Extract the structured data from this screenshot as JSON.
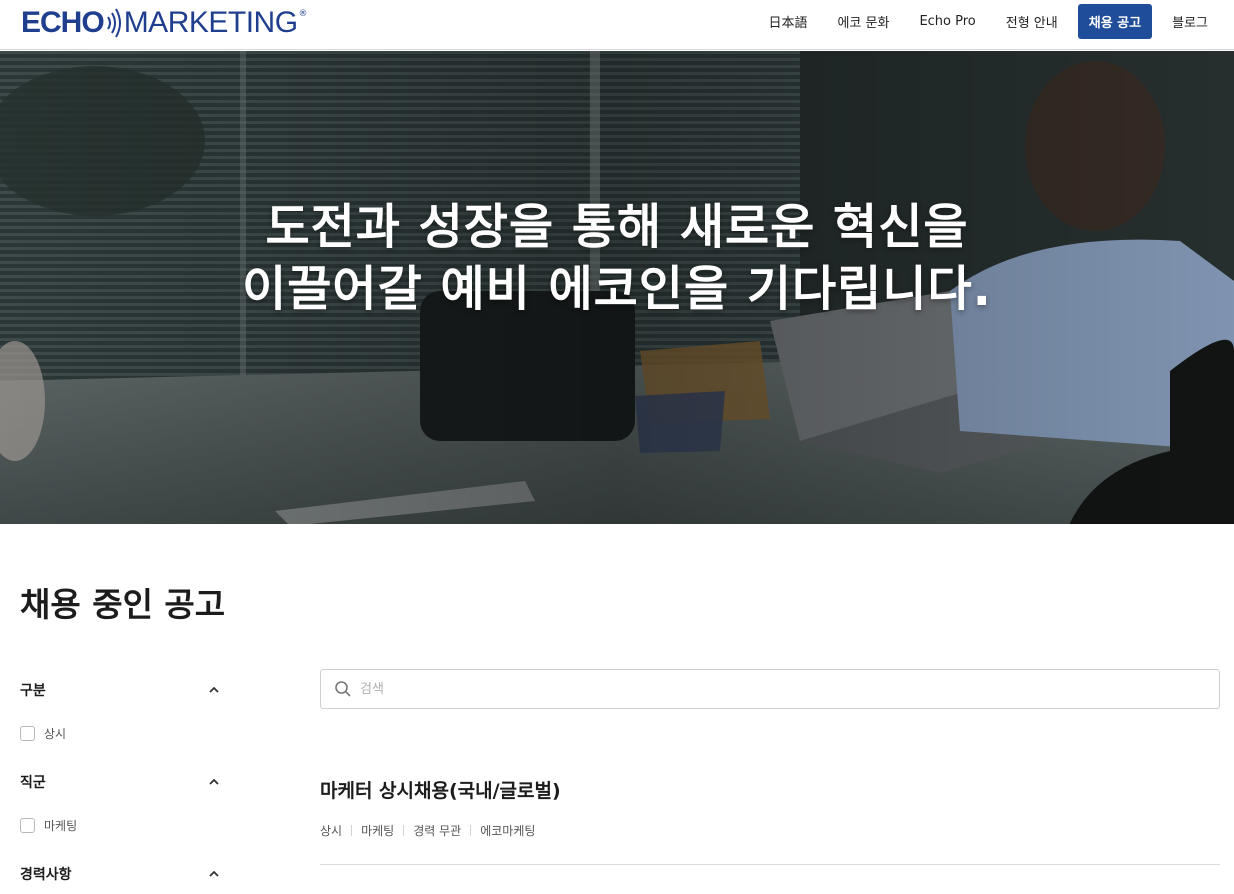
{
  "header": {
    "logo": {
      "brand_bold": "ECHO",
      "brand_light": "MARKETING",
      "reg_mark": "®"
    },
    "nav": [
      {
        "label": "日本語",
        "active": false
      },
      {
        "label": "에코 문화",
        "active": false
      },
      {
        "label": "Echo Pro",
        "active": false
      },
      {
        "label": "전형 안내",
        "active": false
      },
      {
        "label": "채용 공고",
        "active": true
      },
      {
        "label": "블로그",
        "active": false
      }
    ]
  },
  "hero": {
    "line1": "도전과 성장을 통해 새로운 혁신을",
    "line2": "이끌어갈 예비 에코인을 기다립니다."
  },
  "section": {
    "title": "채용 중인 공고"
  },
  "filters": [
    {
      "label": "구분",
      "options": [
        "상시"
      ]
    },
    {
      "label": "직군",
      "options": [
        "마케팅"
      ]
    },
    {
      "label": "경력사항",
      "options": []
    }
  ],
  "search": {
    "placeholder": "검색",
    "value": ""
  },
  "jobs": [
    {
      "title": "마케터 상시채용(국내/글로벌)",
      "tags": [
        "상시",
        "마케팅",
        "경력 무관",
        "에코마케팅"
      ]
    }
  ],
  "colors": {
    "brand": "#1f3f8e",
    "nav_active": "#1f4d9a"
  }
}
